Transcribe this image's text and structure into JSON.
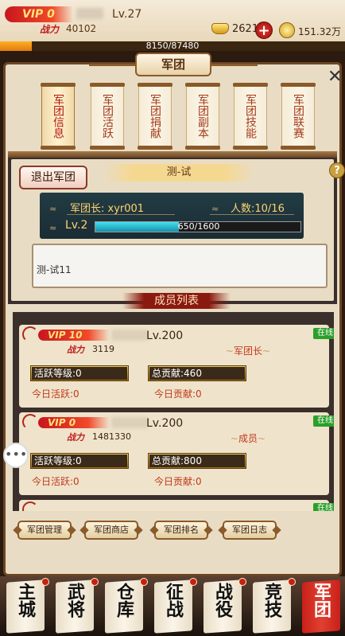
{
  "header": {
    "vip": "VIP 0",
    "level": "Lv.27",
    "power_label": "战力",
    "power": "40102",
    "gold": "2621",
    "coins": "151.32万",
    "exp_text": "8150/87480",
    "exp_fraction": 0.093
  },
  "panel": {
    "title": "军团",
    "close": "✕",
    "tabs": [
      "军团信息",
      "军团活跃",
      "军团捐献",
      "军团副本",
      "军团技能",
      "军团联赛"
    ],
    "active_tab": 0
  },
  "guild": {
    "quit_button": "退出军团",
    "name": "测-试",
    "help": "?",
    "leader": "军团长: xyr001",
    "members_count": "人数:10/16",
    "level": "Lv.2",
    "exp_text": "650/1600",
    "exp_fraction": 0.406,
    "notice": "测-试11",
    "member_list_title": "成员列表"
  },
  "members": [
    {
      "vip": "VIP 10",
      "level": "Lv.200",
      "power_label": "战力",
      "power": "3119",
      "role": "军团长",
      "online": "在线",
      "activity_level": "活跃等级:0",
      "total_contrib": "总贡献:460",
      "today_activity": "今日活跃:0",
      "today_contrib": "今日贡献:0"
    },
    {
      "vip": "VIP 0",
      "level": "Lv.200",
      "power_label": "战力",
      "power": "1481330",
      "role": "成员",
      "online": "在线",
      "activity_level": "活跃等级:0",
      "total_contrib": "总贡献:800",
      "today_activity": "今日活跃:0",
      "today_contrib": "今日贡献:0"
    }
  ],
  "third_member_online": "在线",
  "footer_buttons": [
    "军团管理",
    "军团商店",
    "军团排名",
    "军团日志"
  ],
  "bottom_nav": [
    "主城",
    "武将",
    "仓库",
    "征战",
    "战役",
    "竞技",
    "军团"
  ],
  "colors": {
    "vip_red": "#c8161d",
    "online_green": "#2aa02a",
    "accent_gold": "#ffd470"
  }
}
